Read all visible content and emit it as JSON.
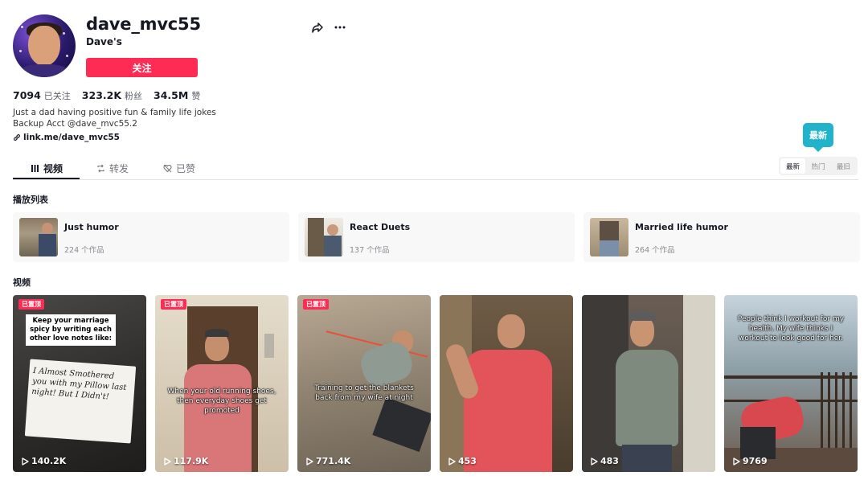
{
  "profile": {
    "username": "dave_mvc55",
    "nickname": "Dave's",
    "follow_label": "关注",
    "stats": [
      {
        "value": "7094",
        "label": "已关注"
      },
      {
        "value": "323.2K",
        "label": "粉丝"
      },
      {
        "value": "34.5M",
        "label": "赞"
      }
    ],
    "bio_line1": "Just a dad having positive fun & family life jokes",
    "bio_line2": "Backup Acct @dave_mvc55.2",
    "link": "link.me/dave_mvc55"
  },
  "tabs": [
    {
      "label": "视频",
      "icon": "grid-icon"
    },
    {
      "label": "转发",
      "icon": "repost-icon"
    },
    {
      "label": "已赞",
      "icon": "liked-icon"
    }
  ],
  "sort": {
    "options": [
      "最新",
      "热门",
      "最旧"
    ],
    "selected": "最新",
    "tooltip": "最新"
  },
  "playlists_title": "播放列表",
  "playlists": [
    {
      "title": "Just humor",
      "count": "224 个作品"
    },
    {
      "title": "React Duets",
      "count": "137 个作品"
    },
    {
      "title": "Married life humor",
      "count": "264 个作品"
    }
  ],
  "videos_title": "视频",
  "videos": [
    {
      "pinned": "已置顶",
      "caption": "Keep your marriage spicy by writing each other love notes like:",
      "note_text": "I Almost Smothered you with my Pillow last night! But I Didn't!",
      "plays": "140.2K"
    },
    {
      "pinned": "已置顶",
      "caption": "When your old running shoes, then everyday shoes get promoted",
      "plays": "117.9K"
    },
    {
      "pinned": "已置顶",
      "caption": "Training to get the blankets back from my wife at night",
      "plays": "771.4K"
    },
    {
      "pinned": "",
      "caption": "",
      "plays": "453"
    },
    {
      "pinned": "",
      "caption": "",
      "plays": "483"
    },
    {
      "pinned": "",
      "caption": "People think I workout for my health. My wife thinks I workout to look good for her.",
      "plays": "9769"
    }
  ],
  "colors": {
    "accent": "#fe2c55",
    "tooltip": "#20b3c9"
  }
}
